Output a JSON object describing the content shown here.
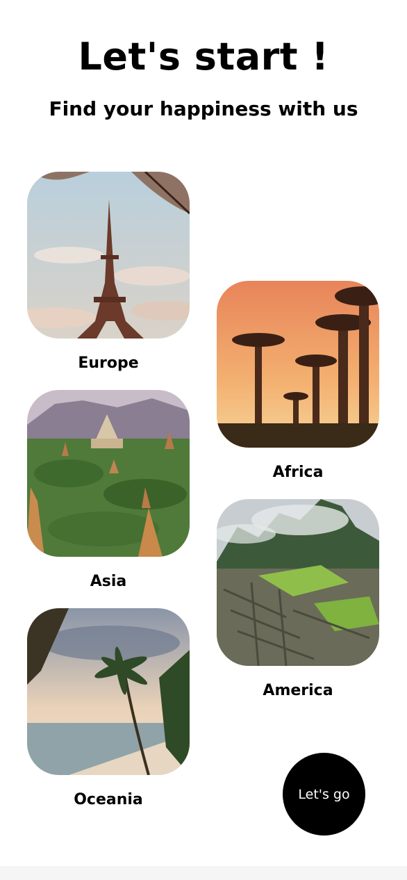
{
  "header": {
    "title": "Let's start !",
    "subtitle": "Find your happiness with us"
  },
  "regions": [
    {
      "name": "Europe"
    },
    {
      "name": "Africa"
    },
    {
      "name": "Asia"
    },
    {
      "name": "America"
    },
    {
      "name": "Oceania"
    }
  ],
  "action": {
    "label": "Let's go"
  },
  "colors": {
    "text": "#000000",
    "button_bg": "#000000",
    "button_text": "#ffffff",
    "background": "#ffffff"
  }
}
